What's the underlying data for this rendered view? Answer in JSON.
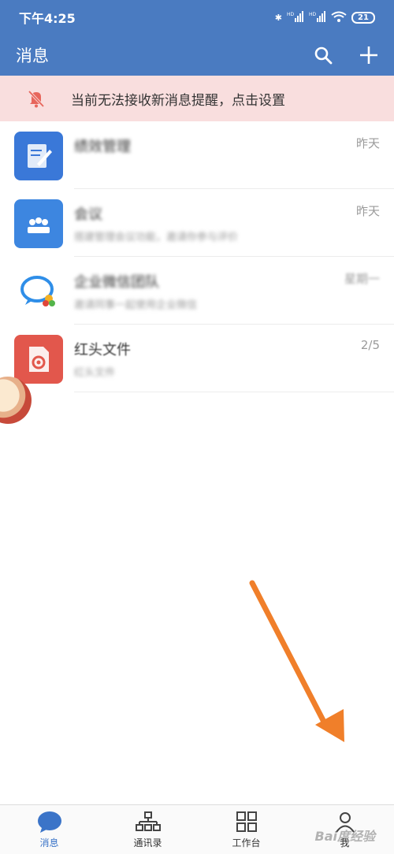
{
  "status_bar": {
    "time": "下午4:25",
    "battery": "21",
    "signal": "HD"
  },
  "app_bar": {
    "title": "消息"
  },
  "notice": {
    "text": "当前无法接收新消息提醒，点击设置"
  },
  "chats": [
    {
      "name": "绩效管理",
      "preview": "",
      "time": "昨天",
      "icon": "edit-doc-icon",
      "color": "#3a78d8"
    },
    {
      "name": "会议",
      "preview": "搭建管理会议功能，邀请你参与评价",
      "time": "昨天",
      "icon": "meeting-icon",
      "color": "#3d86e0"
    },
    {
      "name": "企业微信团队",
      "preview": "邀请同事一起使用企业微信",
      "time": "星期一",
      "icon": "chat-bubble-icon",
      "color": "#2f8ee8"
    },
    {
      "name": "红头文件",
      "preview": "红头文件",
      "time": "2/5",
      "icon": "document-icon",
      "color": "#e2574c"
    }
  ],
  "tabs": [
    {
      "label": "消息",
      "icon": "message-icon",
      "active": true
    },
    {
      "label": "通讯录",
      "icon": "contacts-icon",
      "active": false
    },
    {
      "label": "工作台",
      "icon": "workbench-icon",
      "active": false
    },
    {
      "label": "我",
      "icon": "profile-icon",
      "active": false
    }
  ],
  "watermark": "Bai度经验",
  "colors": {
    "primary": "#4a7bc1",
    "notice_bg": "#f9dede",
    "arrow": "#f07f2a",
    "bell": "#e7665c"
  }
}
